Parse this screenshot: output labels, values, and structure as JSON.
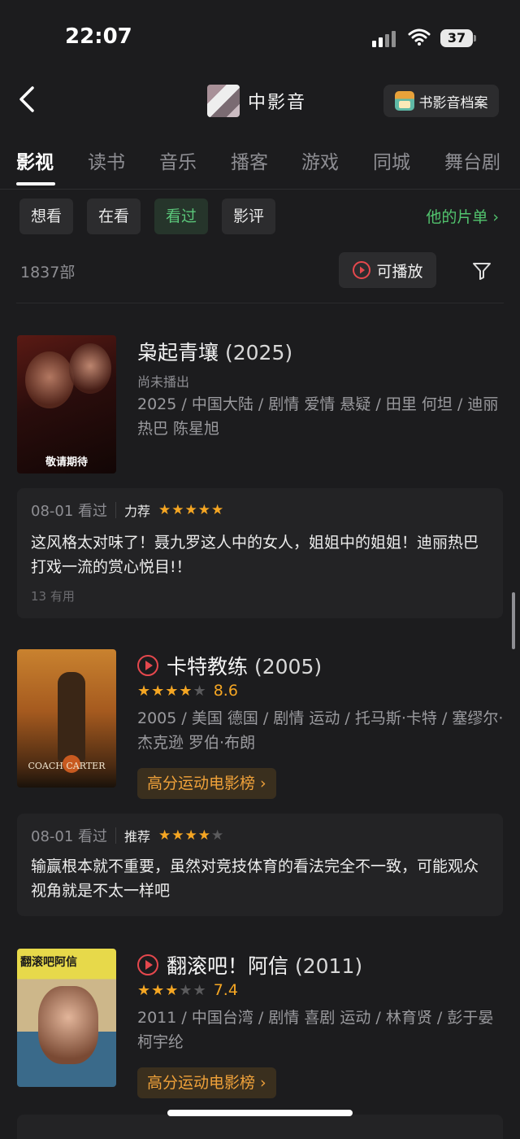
{
  "status_bar": {
    "time": "22:07",
    "battery": "37"
  },
  "nav": {
    "user_name": "中影音",
    "archive_button": "书影音档案"
  },
  "tabs": [
    "影视",
    "读书",
    "音乐",
    "播客",
    "游戏",
    "同城",
    "舞台剧"
  ],
  "filters": {
    "chips": [
      "想看",
      "在看",
      "看过",
      "影评"
    ],
    "active": "看过",
    "list_link": "他的片单 ›"
  },
  "toolbar": {
    "count": "1837部",
    "play_label": "可播放"
  },
  "items": [
    {
      "title": "枭起青壤",
      "year": "(2025)",
      "status": "尚未播出",
      "info": "2025 / 中国大陆 / 剧情 爱情 悬疑 / 田里 何坦 / 迪丽热巴 陈星旭",
      "poster_caption": "敬请期待",
      "review": {
        "date": "08-01 看过",
        "recommend": "力荐",
        "stars": 5,
        "text": "这风格太对味了！聂九罗这人中的女人，姐姐中的姐姐！迪丽热巴打戏一流的赏心悦目!！",
        "useful": "13 有用"
      }
    },
    {
      "title": "卡特教练",
      "year": "(2005)",
      "rating_stars": 4.5,
      "score": "8.6",
      "info": "2005 / 美国 德国 / 剧情 运动 / 托马斯·卡特 / 塞缪尔·杰克逊 罗伯·布朗",
      "poster_caption": "COACH CARTER",
      "rank": "高分运动电影榜 ›",
      "review": {
        "date": "08-01 看过",
        "recommend": "推荐",
        "stars": 4,
        "text": "输赢根本就不重要，虽然对竞技体育的看法完全不一致，可能观众视角就是不太一样吧"
      }
    },
    {
      "title": "翻滚吧！阿信",
      "year": "(2011)",
      "rating_stars": 3.5,
      "score": "7.4",
      "info": "2011 / 中国台湾 / 剧情 喜剧 运动 / 林育贤 / 彭于晏 柯宇纶",
      "poster_caption": "翻滚吧阿信",
      "rank": "高分运动电影榜 ›"
    }
  ],
  "colors": {
    "background": "#1c1c1e",
    "accent_green": "#52c46e",
    "star": "#f5a623",
    "play_red": "#e5484d"
  }
}
